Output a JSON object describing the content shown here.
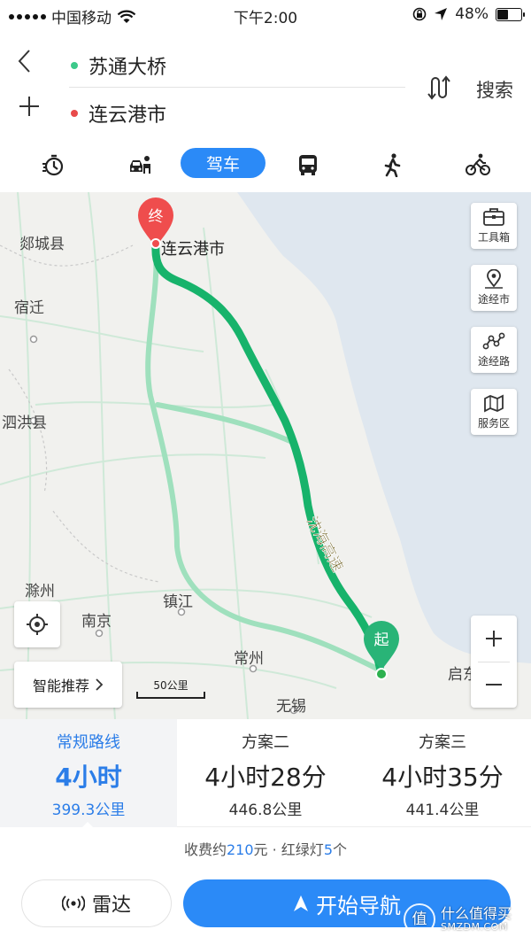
{
  "status_bar": {
    "carrier": "中国移动",
    "time": "下午2:00",
    "battery": "48%",
    "battery_level": 0.48
  },
  "route": {
    "origin": "苏通大桥",
    "destination": "连云港市",
    "search_label": "搜索",
    "origin_color": "#3cc98a",
    "destination_color": "#e84a4a"
  },
  "modes": {
    "active_label": "驾车",
    "items": [
      "taxi-timer-icon",
      "carpool-icon",
      "驾车",
      "bus-icon",
      "walk-icon",
      "bike-icon"
    ]
  },
  "map": {
    "labels": {
      "tancheng": "郯城县",
      "destination": "连云港市",
      "suqian": "宿迁",
      "sihong": "泗洪县",
      "chuzhou": "滁州",
      "nanjing": "南京",
      "zhenjiang": "镇江",
      "changzhou": "常州",
      "wuxi": "无锡",
      "qidong": "启东",
      "highway": "沈海高速"
    },
    "end_marker": "终",
    "start_marker": "起",
    "side_buttons": [
      "工具箱",
      "途经市",
      "途经路",
      "服务区"
    ],
    "smart_recommend": "智能推荐",
    "scale": "50公里",
    "route_color": "#17b36b",
    "alt_route_color": "#8fd9b2",
    "sea_color": "#dfe7ef"
  },
  "options": [
    {
      "name": "常规路线",
      "duration": "4小时",
      "distance": "399.3公里",
      "selected": true
    },
    {
      "name": "方案二",
      "duration": "4小时28分",
      "distance": "446.8公里",
      "selected": false
    },
    {
      "name": "方案三",
      "duration": "4小时35分",
      "distance": "441.4公里",
      "selected": false
    }
  ],
  "fee": {
    "prefix": "收费约",
    "amount": "210",
    "mid": "元 · 红绿灯",
    "lights": "5",
    "suffix": "个"
  },
  "buttons": {
    "radar": "雷达",
    "start": "开始导航"
  },
  "watermark": {
    "logo": "值",
    "line1": "什么值得买",
    "line2": "SMZDM.COM"
  }
}
